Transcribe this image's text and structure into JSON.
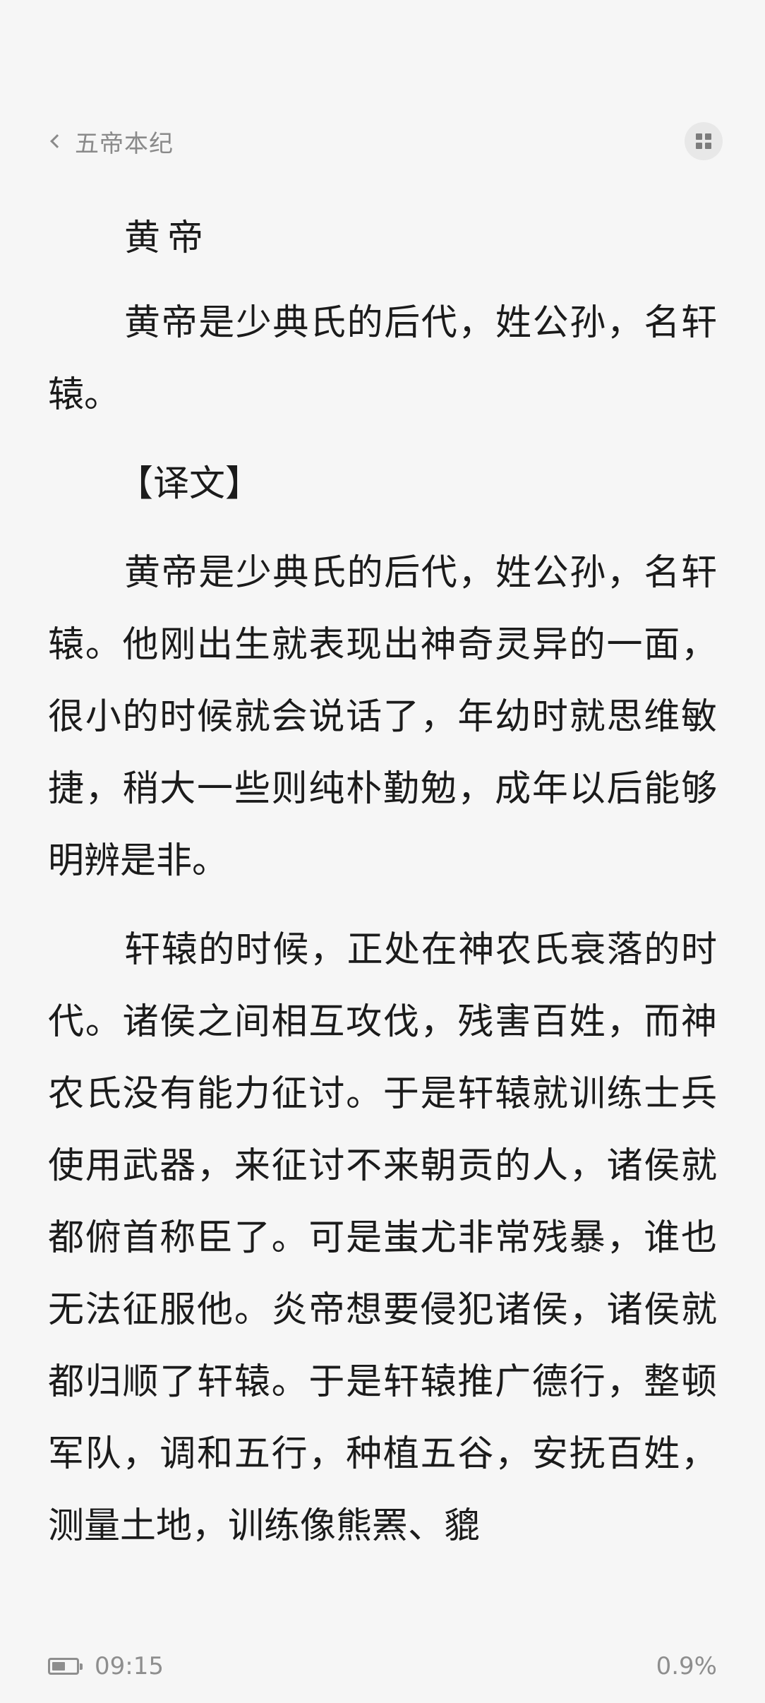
{
  "header": {
    "back_icon": "chevron-left-icon",
    "chapter_title": "五帝本纪",
    "menu_icon": "grid-menu-icon"
  },
  "content": {
    "heading": "黄帝",
    "original": "黄帝是少典氏的后代，姓公孙，名轩辕。",
    "translation_label": "【译文】",
    "paragraphs": [
      "黄帝是少典氏的后代，姓公孙，名轩辕。他刚出生就表现出神奇灵异的一面，很小的时候就会说话了，年幼时就思维敏捷，稍大一些则纯朴勤勉，成年以后能够明辨是非。",
      "轩辕的时候，正处在神农氏衰落的时代。诸侯之间相互攻伐，残害百姓，而神农氏没有能力征讨。于是轩辕就训练士兵使用武器，来征讨不来朝贡的人，诸侯就都俯首称臣了。可是蚩尤非常残暴，谁也无法征服他。炎帝想要侵犯诸侯，诸侯就都归顺了轩辕。于是轩辕推广德行，整顿军队，调和五行，种植五谷，安抚百姓，测量土地，训练像熊罴、貔"
    ]
  },
  "status": {
    "battery_icon": "battery-icon",
    "battery_level": 0.55,
    "time": "09:15",
    "progress": "0.9%"
  },
  "colors": {
    "background": "#f6f6f6",
    "text": "#1b1b1b",
    "muted": "#8a8a8a"
  }
}
